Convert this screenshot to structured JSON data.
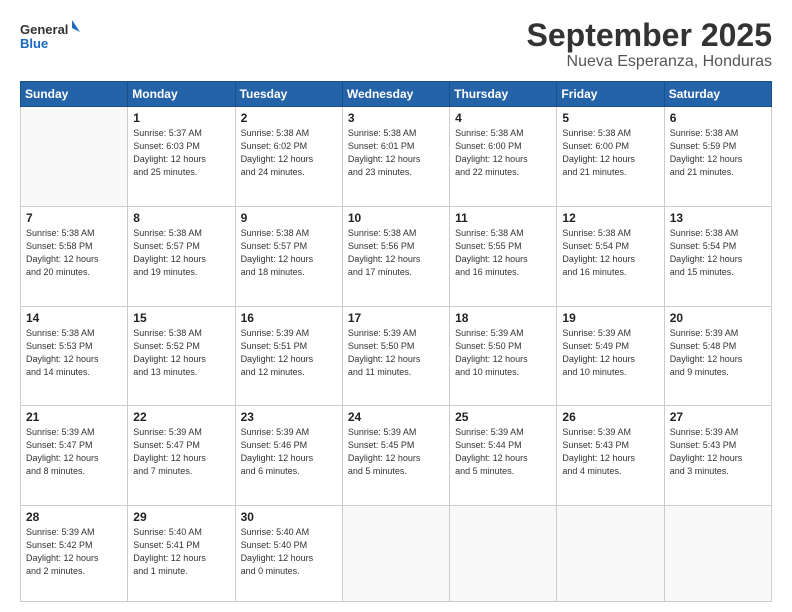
{
  "logo": {
    "line1": "General",
    "line2": "Blue"
  },
  "header": {
    "month": "September 2025",
    "location": "Nueva Esperanza, Honduras"
  },
  "days_of_week": [
    "Sunday",
    "Monday",
    "Tuesday",
    "Wednesday",
    "Thursday",
    "Friday",
    "Saturday"
  ],
  "weeks": [
    [
      {
        "day": "",
        "info": ""
      },
      {
        "day": "1",
        "info": "Sunrise: 5:37 AM\nSunset: 6:03 PM\nDaylight: 12 hours\nand 25 minutes."
      },
      {
        "day": "2",
        "info": "Sunrise: 5:38 AM\nSunset: 6:02 PM\nDaylight: 12 hours\nand 24 minutes."
      },
      {
        "day": "3",
        "info": "Sunrise: 5:38 AM\nSunset: 6:01 PM\nDaylight: 12 hours\nand 23 minutes."
      },
      {
        "day": "4",
        "info": "Sunrise: 5:38 AM\nSunset: 6:00 PM\nDaylight: 12 hours\nand 22 minutes."
      },
      {
        "day": "5",
        "info": "Sunrise: 5:38 AM\nSunset: 6:00 PM\nDaylight: 12 hours\nand 21 minutes."
      },
      {
        "day": "6",
        "info": "Sunrise: 5:38 AM\nSunset: 5:59 PM\nDaylight: 12 hours\nand 21 minutes."
      }
    ],
    [
      {
        "day": "7",
        "info": "Sunrise: 5:38 AM\nSunset: 5:58 PM\nDaylight: 12 hours\nand 20 minutes."
      },
      {
        "day": "8",
        "info": "Sunrise: 5:38 AM\nSunset: 5:57 PM\nDaylight: 12 hours\nand 19 minutes."
      },
      {
        "day": "9",
        "info": "Sunrise: 5:38 AM\nSunset: 5:57 PM\nDaylight: 12 hours\nand 18 minutes."
      },
      {
        "day": "10",
        "info": "Sunrise: 5:38 AM\nSunset: 5:56 PM\nDaylight: 12 hours\nand 17 minutes."
      },
      {
        "day": "11",
        "info": "Sunrise: 5:38 AM\nSunset: 5:55 PM\nDaylight: 12 hours\nand 16 minutes."
      },
      {
        "day": "12",
        "info": "Sunrise: 5:38 AM\nSunset: 5:54 PM\nDaylight: 12 hours\nand 16 minutes."
      },
      {
        "day": "13",
        "info": "Sunrise: 5:38 AM\nSunset: 5:54 PM\nDaylight: 12 hours\nand 15 minutes."
      }
    ],
    [
      {
        "day": "14",
        "info": "Sunrise: 5:38 AM\nSunset: 5:53 PM\nDaylight: 12 hours\nand 14 minutes."
      },
      {
        "day": "15",
        "info": "Sunrise: 5:38 AM\nSunset: 5:52 PM\nDaylight: 12 hours\nand 13 minutes."
      },
      {
        "day": "16",
        "info": "Sunrise: 5:39 AM\nSunset: 5:51 PM\nDaylight: 12 hours\nand 12 minutes."
      },
      {
        "day": "17",
        "info": "Sunrise: 5:39 AM\nSunset: 5:50 PM\nDaylight: 12 hours\nand 11 minutes."
      },
      {
        "day": "18",
        "info": "Sunrise: 5:39 AM\nSunset: 5:50 PM\nDaylight: 12 hours\nand 10 minutes."
      },
      {
        "day": "19",
        "info": "Sunrise: 5:39 AM\nSunset: 5:49 PM\nDaylight: 12 hours\nand 10 minutes."
      },
      {
        "day": "20",
        "info": "Sunrise: 5:39 AM\nSunset: 5:48 PM\nDaylight: 12 hours\nand 9 minutes."
      }
    ],
    [
      {
        "day": "21",
        "info": "Sunrise: 5:39 AM\nSunset: 5:47 PM\nDaylight: 12 hours\nand 8 minutes."
      },
      {
        "day": "22",
        "info": "Sunrise: 5:39 AM\nSunset: 5:47 PM\nDaylight: 12 hours\nand 7 minutes."
      },
      {
        "day": "23",
        "info": "Sunrise: 5:39 AM\nSunset: 5:46 PM\nDaylight: 12 hours\nand 6 minutes."
      },
      {
        "day": "24",
        "info": "Sunrise: 5:39 AM\nSunset: 5:45 PM\nDaylight: 12 hours\nand 5 minutes."
      },
      {
        "day": "25",
        "info": "Sunrise: 5:39 AM\nSunset: 5:44 PM\nDaylight: 12 hours\nand 5 minutes."
      },
      {
        "day": "26",
        "info": "Sunrise: 5:39 AM\nSunset: 5:43 PM\nDaylight: 12 hours\nand 4 minutes."
      },
      {
        "day": "27",
        "info": "Sunrise: 5:39 AM\nSunset: 5:43 PM\nDaylight: 12 hours\nand 3 minutes."
      }
    ],
    [
      {
        "day": "28",
        "info": "Sunrise: 5:39 AM\nSunset: 5:42 PM\nDaylight: 12 hours\nand 2 minutes."
      },
      {
        "day": "29",
        "info": "Sunrise: 5:40 AM\nSunset: 5:41 PM\nDaylight: 12 hours\nand 1 minute."
      },
      {
        "day": "30",
        "info": "Sunrise: 5:40 AM\nSunset: 5:40 PM\nDaylight: 12 hours\nand 0 minutes."
      },
      {
        "day": "",
        "info": ""
      },
      {
        "day": "",
        "info": ""
      },
      {
        "day": "",
        "info": ""
      },
      {
        "day": "",
        "info": ""
      }
    ]
  ]
}
